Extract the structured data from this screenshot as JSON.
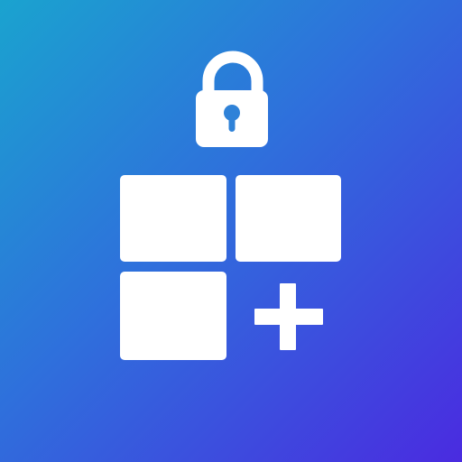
{
  "app_icon": {
    "icon_name": "locked-grid-add-icon",
    "gradient": {
      "start_color": "#1aa3cf",
      "mid_color": "#2f6fdc",
      "end_color": "#4a2be0"
    },
    "glyph_color": "#ffffff",
    "elements": {
      "lock": "lock-icon",
      "keyhole": "keyhole-icon",
      "tiles": [
        "grid-tile-top-left",
        "grid-tile-top-right",
        "grid-tile-bottom-left"
      ],
      "plus": "plus-icon"
    }
  }
}
